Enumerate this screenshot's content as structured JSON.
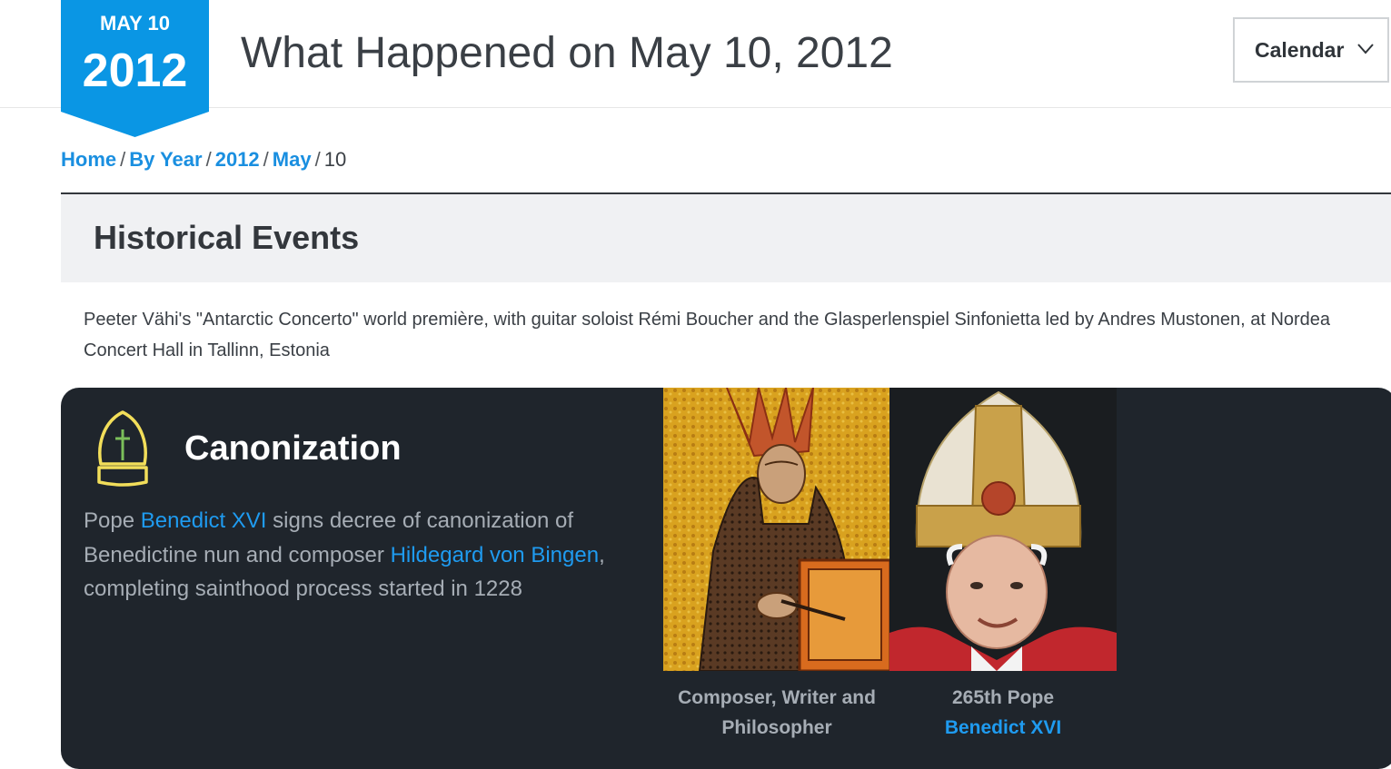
{
  "header": {
    "badge_month": "MAY 10",
    "badge_year": "2012",
    "title": "What Happened on May 10, 2012",
    "calendar_label": "Calendar"
  },
  "breadcrumb": {
    "home": "Home",
    "by_year": "By Year",
    "year": "2012",
    "month": "May",
    "day": "10",
    "separator": "/"
  },
  "section": {
    "title": "Historical Events",
    "event_text": "Peeter Vähi's \"Antarctic Concerto\" world première, with guitar soloist Rémi Boucher and the Glasperlenspiel Sinfonietta led by Andres Mustonen, at Nordea Concert Hall in Tallinn, Estonia"
  },
  "featured": {
    "icon": "mitre-icon",
    "title": "Canonization",
    "text_1": "Pope ",
    "link_1": "Benedict XVI",
    "text_2": " signs decree of canonization of Benedictine nun and composer ",
    "link_2": "Hildegard von Bingen",
    "text_3": ", completing sainthood process started in 1228",
    "portraits": [
      {
        "caption": "Composer, Writer and Philosopher",
        "link": ""
      },
      {
        "caption": "265th Pope",
        "link": "Benedict XVI"
      }
    ]
  },
  "colors": {
    "accent_blue": "#0a96e4",
    "link_blue": "#1a8fe0",
    "card_bg": "#1f252c",
    "icon_yellow": "#f2de5a",
    "icon_green": "#7bbf5a"
  }
}
